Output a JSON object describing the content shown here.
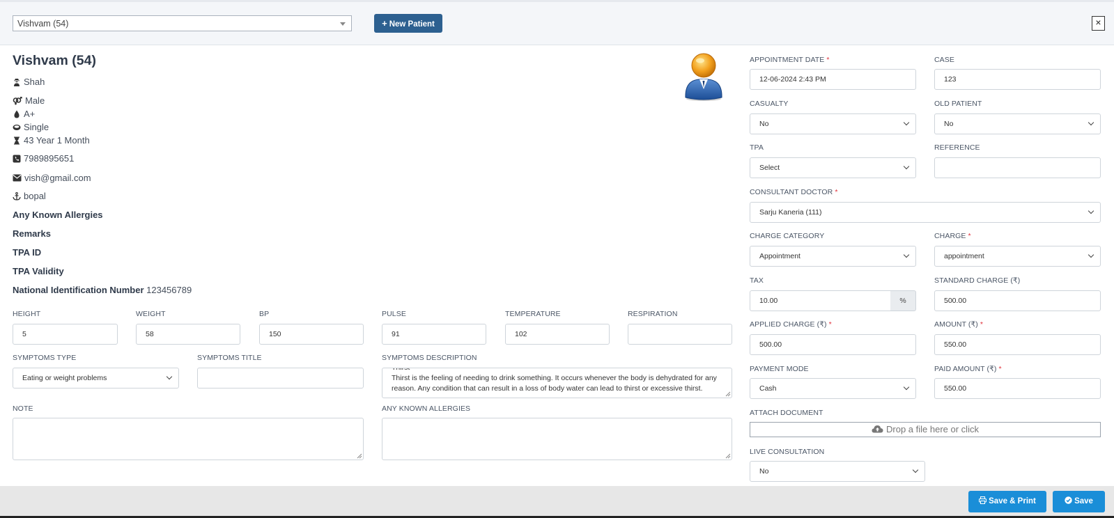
{
  "header": {
    "patient_select_value": "Vishvam (54)",
    "new_patient_label": "New Patient",
    "close_label": "×"
  },
  "patient": {
    "name": "Vishvam (54)",
    "guardian": "Shah",
    "gender": "Male",
    "blood_group": "A+",
    "marital_status": "Single",
    "age": "43 Year 1 Month",
    "phone": "7989895651",
    "email": "vish@gmail.com",
    "address": "bopal",
    "allergies_label": "Any Known Allergies",
    "remarks_label": "Remarks",
    "tpa_id_label": "TPA ID",
    "tpa_validity_label": "TPA Validity",
    "nin_label": "National Identification Number",
    "nin_value": "123456789"
  },
  "vitals": {
    "height_label": "HEIGHT",
    "height": "5",
    "weight_label": "WEIGHT",
    "weight": "58",
    "bp_label": "BP",
    "bp": "150",
    "pulse_label": "PULSE",
    "pulse": "91",
    "temperature_label": "TEMPERATURE",
    "temperature": "102",
    "respiration_label": "RESPIRATION",
    "respiration": ""
  },
  "symptoms": {
    "type_label": "SYMPTOMS TYPE",
    "type_value": "Eating or weight problems",
    "title_label": "SYMPTOMS TITLE",
    "title_value": "",
    "description_label": "SYMPTOMS DESCRIPTION",
    "description_value": "Thirst\nThirst is the feeling of needing to drink something. It occurs whenever the body is dehydrated for any reason. Any condition that can result in a loss of body water can lead to thirst or excessive thirst."
  },
  "notes": {
    "note_label": "NOTE",
    "note_value": "",
    "allergies_label": "ANY KNOWN ALLERGIES",
    "allergies_value": ""
  },
  "appointment": {
    "date_label": "APPOINTMENT DATE",
    "date_value": "12-06-2024 2:43 PM",
    "case_label": "CASE",
    "case_value": "123",
    "casualty_label": "CASUALTY",
    "casualty_value": "No",
    "old_patient_label": "OLD PATIENT",
    "old_patient_value": "No",
    "tpa_label": "TPA",
    "tpa_value": "Select",
    "reference_label": "REFERENCE",
    "reference_value": "",
    "consultant_label": "CONSULTANT DOCTOR",
    "consultant_value": "Sarju Kaneria (111)",
    "charge_category_label": "CHARGE CATEGORY",
    "charge_category_value": "Appointment",
    "charge_label": "CHARGE",
    "charge_value": "appointment",
    "tax_label": "TAX",
    "tax_value": "10.00",
    "tax_unit": "%",
    "standard_charge_label": "STANDARD CHARGE (₹)",
    "standard_charge_value": "500.00",
    "applied_charge_label": "APPLIED CHARGE (₹)",
    "applied_charge_value": "500.00",
    "amount_label": "AMOUNT (₹)",
    "amount_value": "550.00",
    "payment_mode_label": "PAYMENT MODE",
    "payment_mode_value": "Cash",
    "paid_amount_label": "PAID AMOUNT (₹)",
    "paid_amount_value": "550.00",
    "attach_label": "ATTACH DOCUMENT",
    "attach_placeholder": "Drop a file here or click",
    "live_consultation_label": "LIVE CONSULTATION",
    "live_consultation_value": "No",
    "required_mark": "*"
  },
  "footer": {
    "save_print_label": "Save & Print",
    "save_label": "Save"
  },
  "colors": {
    "primary_button": "#2d6090",
    "save_button": "#1a8ed8",
    "required": "#e0313b"
  },
  "icons": [
    "user-secret-icon",
    "venus-mars-icon",
    "tint-icon",
    "ring-icon",
    "hourglass-icon",
    "phone-icon",
    "envelope-icon",
    "anchor-icon",
    "cloud-upload-icon",
    "print-icon",
    "check-circle-icon",
    "avatar-icon"
  ]
}
